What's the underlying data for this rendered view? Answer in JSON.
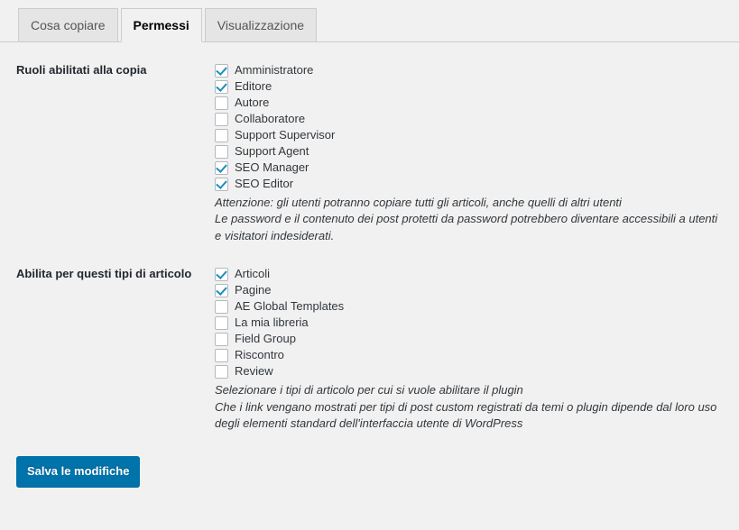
{
  "tabs": [
    {
      "label": "Cosa copiare",
      "active": false
    },
    {
      "label": "Permessi",
      "active": true
    },
    {
      "label": "Visualizzazione",
      "active": false
    }
  ],
  "sections": [
    {
      "title": "Ruoli abilitati alla copia",
      "options": [
        {
          "label": "Amministratore",
          "checked": true
        },
        {
          "label": "Editore",
          "checked": true
        },
        {
          "label": "Autore",
          "checked": false
        },
        {
          "label": "Collaboratore",
          "checked": false
        },
        {
          "label": "Support Supervisor",
          "checked": false
        },
        {
          "label": "Support Agent",
          "checked": false
        },
        {
          "label": "SEO Manager",
          "checked": true
        },
        {
          "label": "SEO Editor",
          "checked": true
        }
      ],
      "description": [
        "Attenzione: gli utenti potranno copiare tutti gli articoli, anche quelli di altri utenti",
        "Le password e il contenuto dei post protetti da password potrebbero diventare accessibili a utenti e visitatori indesiderati."
      ]
    },
    {
      "title": "Abilita per questi tipi di articolo",
      "options": [
        {
          "label": "Articoli",
          "checked": true
        },
        {
          "label": "Pagine",
          "checked": true
        },
        {
          "label": "AE Global Templates",
          "checked": false
        },
        {
          "label": "La mia libreria",
          "checked": false
        },
        {
          "label": "Field Group",
          "checked": false
        },
        {
          "label": "Riscontro",
          "checked": false
        },
        {
          "label": "Review",
          "checked": false
        }
      ],
      "description": [
        "Selezionare i tipi di articolo per cui si vuole abilitare il plugin",
        "Che i link vengano mostrati per tipi di post custom registrati da temi o plugin dipende dal loro uso degli elementi standard dell'interfaccia utente di WordPress"
      ]
    }
  ],
  "submit": {
    "label": "Salva le modifiche"
  },
  "colors": {
    "accent": "#0073aa",
    "checkmark": "#1e8cbe",
    "background": "#f1f1f1",
    "tab_inactive": "#e5e5e5",
    "border": "#cccccc"
  }
}
